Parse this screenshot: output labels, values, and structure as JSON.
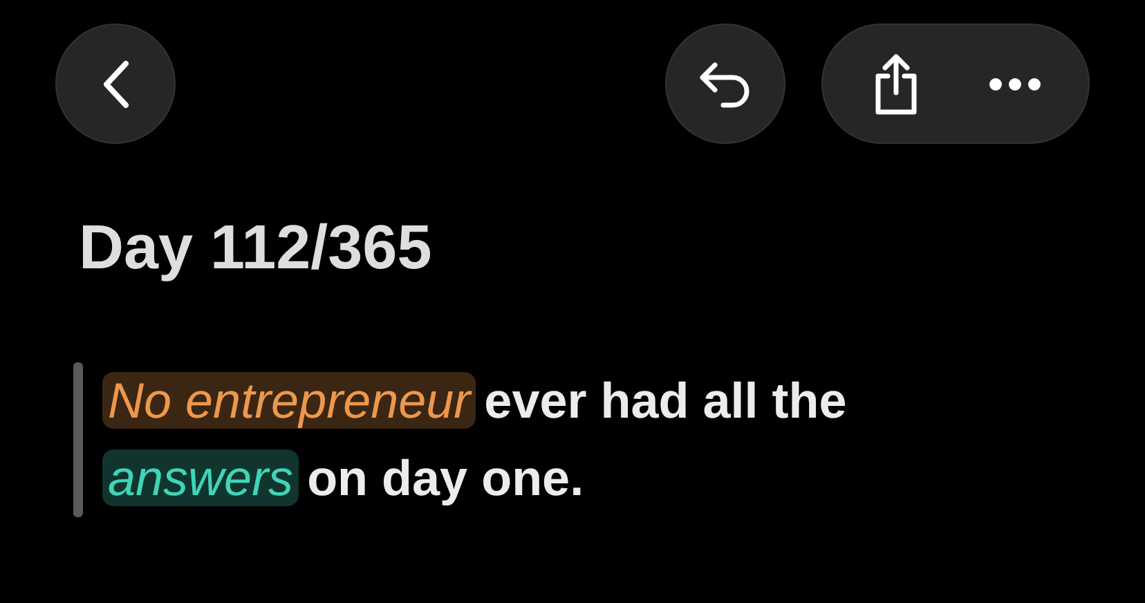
{
  "title": "Day 112/365",
  "quote": {
    "lines": [
      [
        {
          "kind": "highlight",
          "text": "No entrepreneur",
          "color": "#3b2613"
        },
        {
          "kind": "plain",
          "text": "ever had all the"
        }
      ],
      [
        {
          "kind": "highlight",
          "text": "answers",
          "color": "#10352e"
        },
        {
          "kind": "plain",
          "text": "on day one."
        }
      ]
    ]
  }
}
